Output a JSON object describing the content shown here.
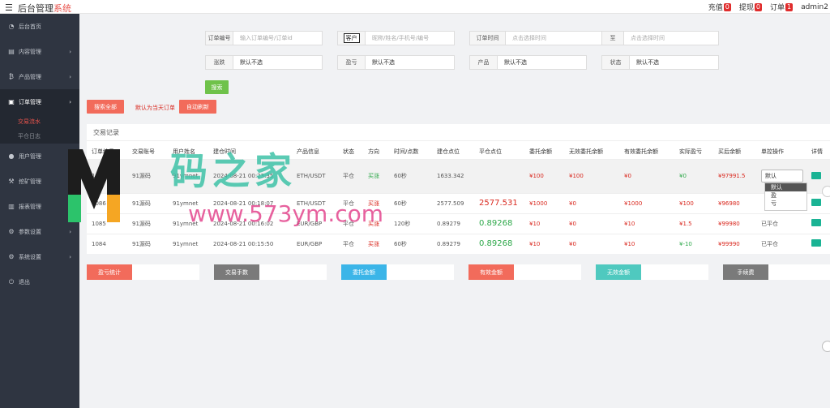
{
  "header": {
    "menu_icon": "hamburger-icon",
    "title_main": "后台管理",
    "title_accent": "系统",
    "items": [
      {
        "label": "充值",
        "count": "0"
      },
      {
        "label": "提现",
        "count": "0"
      },
      {
        "label": "订单",
        "count": "1"
      }
    ],
    "user": "admin2"
  },
  "sidebar": {
    "items": [
      {
        "label": "后台首页",
        "icon": "dashboard-icon"
      },
      {
        "label": "内容管理",
        "icon": "book-icon"
      },
      {
        "label": "产品管理",
        "icon": "bitcoin-icon"
      },
      {
        "label": "订单管理",
        "icon": "order-icon"
      },
      {
        "label": "交易流水",
        "sub": true
      },
      {
        "label": "平仓日志",
        "sub": true
      },
      {
        "label": "用户管理",
        "icon": "user-icon"
      },
      {
        "label": "挖矿管理",
        "icon": "mining-icon"
      },
      {
        "label": "报表管理",
        "icon": "report-icon"
      },
      {
        "label": "参数设置",
        "icon": "gear-icon"
      },
      {
        "label": "系统设置",
        "icon": "cogs-icon"
      },
      {
        "label": "退出",
        "icon": "logout-icon"
      }
    ]
  },
  "filters": {
    "order_no_label": "订单编号",
    "order_no_placeholder": "输入订单编号/订单id",
    "customer_label": "客户",
    "customer_placeholder": "昵称/姓名/手机号/编号",
    "time_label": "订单时间",
    "time_placeholder": "点击选择时间",
    "to_label": "至",
    "to_placeholder": "点击选择时间",
    "direction_label": "涨跌",
    "direction_value": "默认不选",
    "profit_label": "盈亏",
    "profit_value": "默认不选",
    "product_label": "产品",
    "product_value": "默认不选",
    "status_label": "状态",
    "status_value": "默认不选",
    "search_btn": "搜索",
    "search_all_btn": "搜索全部",
    "default_note": "默认为当天订单",
    "auto_refresh_btn": "自动刷新"
  },
  "table": {
    "title": "交易记录",
    "headers": [
      "订单编号",
      "交易账号",
      "用户姓名",
      "建仓时间",
      "产品信息",
      "状态",
      "方向",
      "时间/点数",
      "建仓点位",
      "平仓点位",
      "委托余额",
      "无效委托余额",
      "有效委托余额",
      "实际盈亏",
      "买后余额",
      "单控操作",
      "详情"
    ],
    "rows": [
      {
        "id": "1087",
        "account": "91源码",
        "name": "91ymnet",
        "time": "2024-08-21 00:23:35",
        "product": "ETH/USDT",
        "status": "平仓",
        "direction": "买涨",
        "period": "60秒",
        "open": "1633.342",
        "close": "",
        "entrust": "¥100",
        "invalid": "¥100",
        "valid": "¥0",
        "profit": "¥0",
        "after": "¥97991.5",
        "control": "默认"
      },
      {
        "id": "1086",
        "account": "91源码",
        "name": "91ymnet",
        "time": "2024-08-21 00:18:07",
        "product": "ETH/USDT",
        "status": "平仓",
        "direction": "买涨",
        "period": "60秒",
        "open": "2577.509",
        "close": "2577.531",
        "entrust": "¥1000",
        "invalid": "¥0",
        "valid": "¥1000",
        "profit": "¥100",
        "after": "¥96980",
        "control": ""
      },
      {
        "id": "1085",
        "account": "91源码",
        "name": "91ymnet",
        "time": "2024-08-21 00:16:02",
        "product": "EUR/GBP",
        "status": "平仓",
        "direction": "买涨",
        "period": "120秒",
        "open": "0.89279",
        "close": "0.89268",
        "entrust": "¥10",
        "invalid": "¥0",
        "valid": "¥10",
        "profit": "¥1.5",
        "after": "¥99980",
        "control": "已平仓"
      },
      {
        "id": "1084",
        "account": "91源码",
        "name": "91ymnet",
        "time": "2024-08-21 00:15:50",
        "product": "EUR/GBP",
        "status": "平仓",
        "direction": "买涨",
        "period": "60秒",
        "open": "0.89279",
        "close": "0.89268",
        "entrust": "¥10",
        "invalid": "¥0",
        "valid": "¥10",
        "profit": "¥-10",
        "after": "¥99990",
        "control": "已平仓"
      }
    ],
    "dropdown_options": [
      "默认",
      "盈",
      "亏"
    ]
  },
  "stats": [
    {
      "label": "盈亏统计",
      "color": "#f26b5b"
    },
    {
      "label": "交易手数",
      "color": "#7a7a7a"
    },
    {
      "label": "委托金额",
      "color": "#3bb5e8"
    },
    {
      "label": "有效金额",
      "color": "#f26b5b"
    },
    {
      "label": "无效金额",
      "color": "#4fc9bf"
    },
    {
      "label": "手续费",
      "color": "#7a7a7a"
    }
  ],
  "watermark": {
    "text": "码之家",
    "url": "www.573ym.com"
  }
}
